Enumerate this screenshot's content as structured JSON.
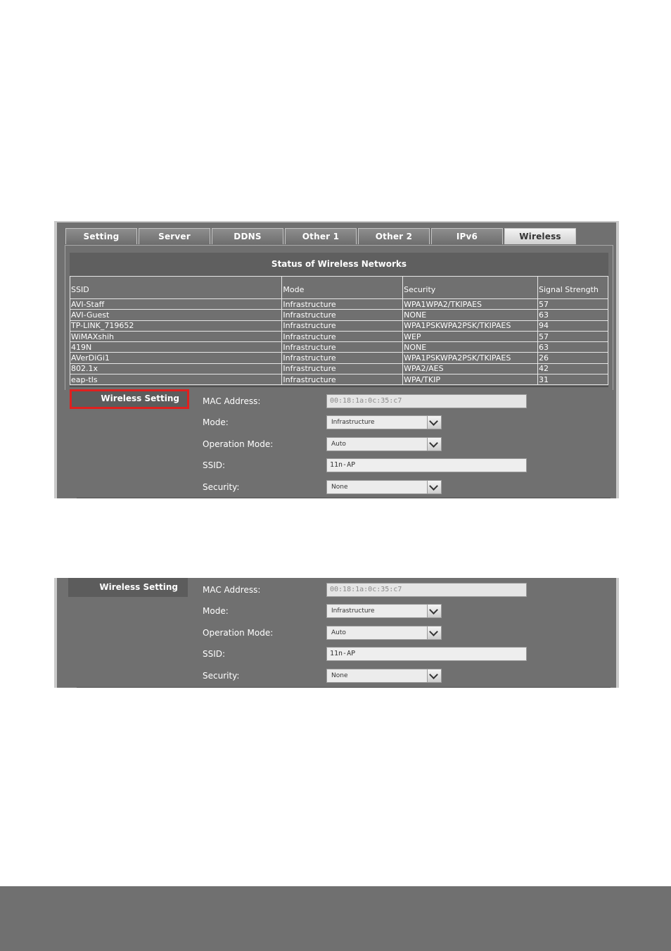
{
  "tabs": [
    {
      "label": "Setting"
    },
    {
      "label": "Server"
    },
    {
      "label": "DDNS"
    },
    {
      "label": "Other 1"
    },
    {
      "label": "Other 2"
    },
    {
      "label": "IPv6"
    },
    {
      "label": "Wireless",
      "active": true
    }
  ],
  "status": {
    "title": "Status of Wireless Networks",
    "columns": [
      "SSID",
      "Mode",
      "Security",
      "Signal Strength"
    ],
    "rows": [
      [
        "AVI-Staff",
        "Infrastructure",
        "WPA1WPA2/TKIPAES",
        "57"
      ],
      [
        "AVI-Guest",
        "Infrastructure",
        "NONE",
        "63"
      ],
      [
        "TP-LINK_719652",
        "Infrastructure",
        "WPA1PSKWPA2PSK/TKIPAES",
        "94"
      ],
      [
        "WiMAXshih",
        "Infrastructure",
        "WEP",
        "57"
      ],
      [
        "419N",
        "Infrastructure",
        "NONE",
        "63"
      ],
      [
        "AVerDiGi1",
        "Infrastructure",
        "WPA1PSKWPA2PSK/TKIPAES",
        "26"
      ],
      [
        "802.1x",
        "Infrastructure",
        "WPA2/AES",
        "42"
      ],
      [
        "eap-tls",
        "Infrastructure",
        "WPA/TKIP",
        "31"
      ]
    ]
  },
  "wireless_setting": {
    "section_label": "Wireless Setting",
    "mac_label": "MAC Address:",
    "mac_value": "00:18:1a:0c:35:c7",
    "mode_label": "Mode:",
    "mode_value_first": "Infrastructure",
    "mode_value": "Infrastructure",
    "opmode_label": "Operation Mode:",
    "opmode_value": "Auto",
    "ssid_label": "SSID:",
    "ssid_value": "11n-AP",
    "security_label": "Security:",
    "security_value": "None"
  },
  "colors": {
    "panel_bg": "#707070",
    "header_bg": "#5f5f5f",
    "highlight_border": "#e0201e"
  }
}
